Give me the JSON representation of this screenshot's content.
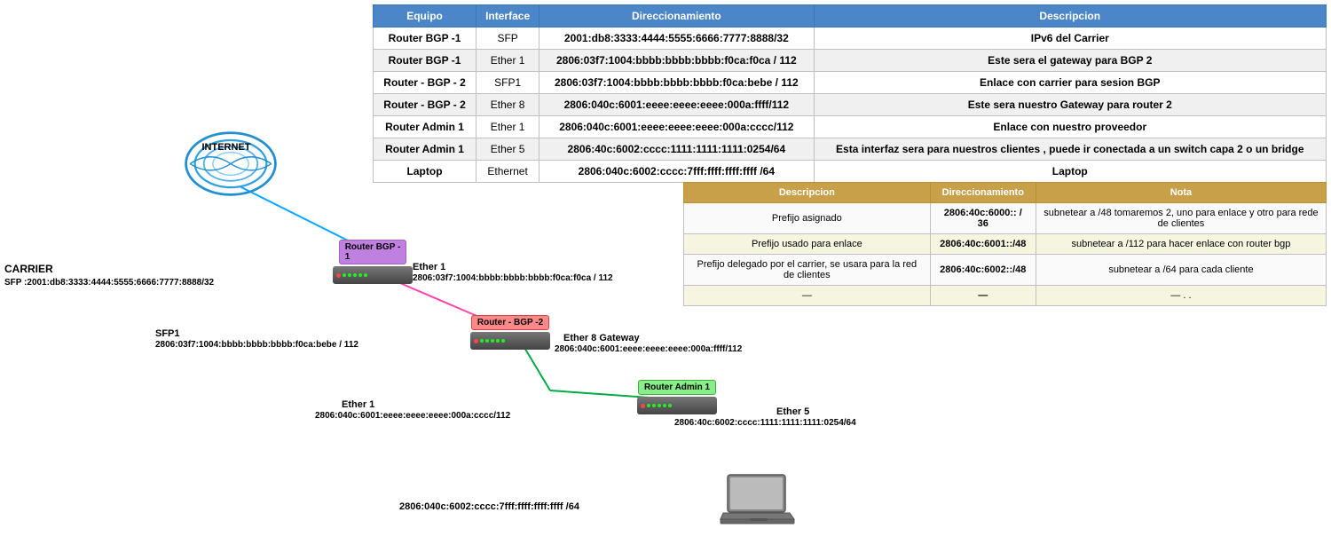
{
  "table": {
    "headers": [
      "Equipo",
      "Interface",
      "Direccionamiento",
      "Descripcion"
    ],
    "rows": [
      {
        "equipo": "Router BGP -1",
        "interface": "SFP",
        "direccionamiento": "2001:db8:3333:4444:5555:6666:7777:8888/32",
        "descripcion": "IPv6 del Carrier"
      },
      {
        "equipo": "Router BGP -1",
        "interface": "Ether 1",
        "direccionamiento": "2806:03f7:1004:bbbb:bbbb:bbbb:f0ca:f0ca / 112",
        "descripcion": "Este sera el gateway para BGP 2"
      },
      {
        "equipo": "Router - BGP - 2",
        "interface": "SFP1",
        "direccionamiento": "2806:03f7:1004:bbbb:bbbb:bbbb:f0ca:bebe / 112",
        "descripcion": "Enlace con carrier para sesion BGP"
      },
      {
        "equipo": "Router - BGP - 2",
        "interface": "Ether 8",
        "direccionamiento": "2806:040c:6001:eeee:eeee:eeee:000a:ffff/112",
        "descripcion": "Este sera nuestro Gateway para router 2"
      },
      {
        "equipo": "Router Admin 1",
        "interface": "Ether 1",
        "direccionamiento": "2806:040c:6001:eeee:eeee:eeee:000a:cccc/112",
        "descripcion": "Enlace con nuestro proveedor"
      },
      {
        "equipo": "Router Admin 1",
        "interface": "Ether 5",
        "direccionamiento": "2806:40c:6002:cccc:1111:1111:1111:0254/64",
        "descripcion": "Esta interfaz sera para nuestros clientes , puede ir conectada a un switch capa 2 o un bridge"
      },
      {
        "equipo": "Laptop",
        "interface": "Ethernet",
        "direccionamiento": "2806:040c:6002:cccc:7fff:ffff:ffff:ffff /64",
        "descripcion": "Laptop"
      }
    ]
  },
  "second_table": {
    "headers": [
      "Descripcion",
      "Direccionamiento",
      "Nota"
    ],
    "rows": [
      {
        "descripcion": "Prefijo asignado",
        "direccionamiento": "2806:40c:6000:: / 36",
        "nota": "subnetear a /48  tomaremos 2, uno para enlace y otro para rede de clientes"
      },
      {
        "descripcion": "Prefijo usado para enlace",
        "direccionamiento": "2806:40c:6001::/48",
        "nota": "subnetear a /112 para hacer enlace con router bgp"
      },
      {
        "descripcion": "Prefijo delegado por el carrier, se usara para la red de clientes",
        "direccionamiento": "2806:40c:6002::/48",
        "nota": "subnetear a /64 para cada cliente"
      },
      {
        "descripcion": "—",
        "direccionamiento": "—",
        "nota": "— . ."
      }
    ]
  },
  "diagram": {
    "internet_label": "INTERNET",
    "carrier_label": "CARRIER",
    "carrier_sfp": "SFP :2001:db8:3333:4444:5555:6666:7777:8888/32",
    "router_bgp1_label": "Router BGP -\n1",
    "router_bgp1_ether1": "Ether 1",
    "router_bgp1_addr": "2806:03f7:1004:bbbb:bbbb:bbbb:f0ca:f0ca / 112",
    "router_bgp2_label": "Router - BGP -2",
    "router_bgp2_sfp1": "SFP1",
    "router_bgp2_addr": "2806:03f7:1004:bbbb:bbbb:bbbb:f0ca:bebe / 112",
    "router_bgp2_ether8_label": "Ether 8 Gateway",
    "router_bgp2_ether8_addr": "2806:040c:6001:eeee:eeee:eeee:000a:ffff/112",
    "router_admin1_label": "Router Admin 1",
    "router_admin1_ether1": "Ether 1",
    "router_admin1_ether1_addr": "2806:040c:6001:eeee:eeee:eeee:000a:cccc/112",
    "router_admin1_ether5": "Ether 5",
    "router_admin1_ether5_addr": "2806:40c:6002:cccc:1111:1111:1111:0254/64",
    "laptop_addr": "2806:040c:6002:cccc:7fff:ffff:ffff:ffff /64"
  }
}
